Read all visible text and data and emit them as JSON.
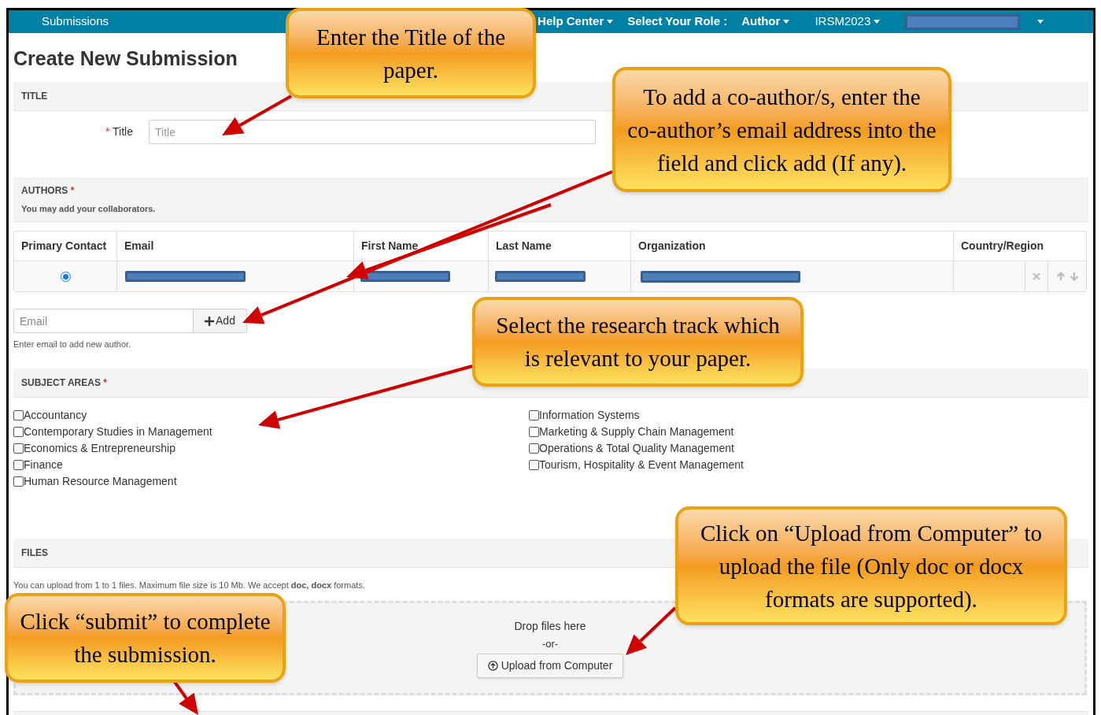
{
  "navbar": {
    "brand": "Submissions",
    "items": [
      {
        "label": "Help Center",
        "bold": true,
        "caret": true
      },
      {
        "label": "Select Your Role :",
        "bold": true,
        "caret": false
      },
      {
        "label": "Author",
        "bold": true,
        "caret": true
      },
      {
        "label": "IRSM2023",
        "bold": false,
        "caret": true
      }
    ]
  },
  "page_title": "Create New Submission",
  "title_section": {
    "heading": "TITLE",
    "label": "Title",
    "required_mark": "*",
    "placeholder": "Title"
  },
  "authors_section": {
    "heading": "AUTHORS",
    "required_mark": "*",
    "note": "You may add your collaborators.",
    "columns": [
      "Primary Contact",
      "Email",
      "First Name",
      "Last Name",
      "Organization",
      "Country/Region"
    ],
    "rows": [
      {
        "selected": true
      }
    ],
    "email_placeholder": "Email",
    "add_button": "Add",
    "help": "Enter email to add new author."
  },
  "subject_section": {
    "heading": "SUBJECT AREAS",
    "required_mark": "*",
    "options": [
      {
        "label": "Accountancy",
        "checked": false
      },
      {
        "label": "Contemporary Studies in Management",
        "checked": false
      },
      {
        "label": "Economics & Entrepreneurship",
        "checked": false
      },
      {
        "label": "Finance",
        "checked": false
      },
      {
        "label": "Human Resource Management",
        "checked": false
      },
      {
        "label": "Information Systems",
        "checked": false
      },
      {
        "label": "Marketing & Supply Chain Management",
        "checked": false
      },
      {
        "label": "Operations & Total Quality Management",
        "checked": false
      },
      {
        "label": "Tourism, Hospitality & Event Management",
        "checked": false
      }
    ]
  },
  "files_section": {
    "heading": "FILES",
    "note": "You can upload from 1 to 1 files. Maximum file size is 10 Mb. We accept **doc, docx** formats.",
    "drop_text": "Drop files here",
    "or_text": "-or-",
    "upload_button": "Upload from Computer"
  },
  "annotations": [
    {
      "text": "Enter the Title of the paper."
    },
    {
      "text": "To add a co-author/s, enter the co-author’s email address into the field and click add (If any)."
    },
    {
      "text": "Select the research track which is relevant to your paper."
    },
    {
      "text": "Click on “Upload from Computer” to upload the file (Only doc or docx formats are supported)."
    },
    {
      "text": "Click “submit” to complete the submission."
    }
  ]
}
